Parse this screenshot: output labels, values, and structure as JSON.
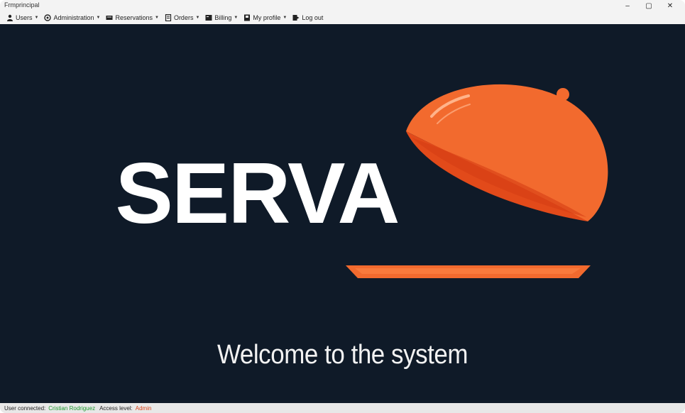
{
  "window": {
    "title": "Frmprincipal",
    "minimize_glyph": "–",
    "maximize_glyph": "▢",
    "close_glyph": "✕"
  },
  "menu": {
    "items": [
      {
        "label": "Users",
        "icon": "user-icon"
      },
      {
        "label": "Administration",
        "icon": "settings-icon"
      },
      {
        "label": "Reservations",
        "icon": "reservations-icon"
      },
      {
        "label": "Orders",
        "icon": "orders-icon"
      },
      {
        "label": "Billing",
        "icon": "billing-icon"
      },
      {
        "label": "My profile",
        "icon": "profile-icon"
      },
      {
        "label": "Log out",
        "icon": "logout-icon"
      }
    ],
    "caret": "▼"
  },
  "brand": {
    "name": "SERVA",
    "accent_color": "#f26a2e",
    "background_color": "#0f1a28"
  },
  "welcome": {
    "text": "Welcome to the system"
  },
  "status": {
    "user_label": "User connected:",
    "user_value": "Cristian Rodriguez",
    "level_label": "Access level:",
    "level_value": "Admin"
  }
}
